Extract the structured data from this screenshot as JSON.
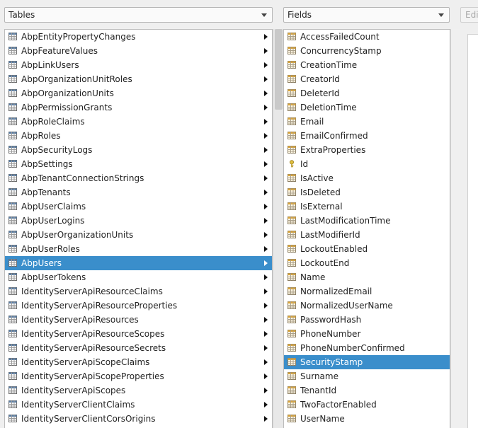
{
  "tables_combo": {
    "label": "Tables"
  },
  "fields_combo": {
    "label": "Fields"
  },
  "edit_button": {
    "label": "Edit"
  },
  "tables": {
    "selected": "AbpUsers",
    "items": [
      "AbpEntityPropertyChanges",
      "AbpFeatureValues",
      "AbpLinkUsers",
      "AbpOrganizationUnitRoles",
      "AbpOrganizationUnits",
      "AbpPermissionGrants",
      "AbpRoleClaims",
      "AbpRoles",
      "AbpSecurityLogs",
      "AbpSettings",
      "AbpTenantConnectionStrings",
      "AbpTenants",
      "AbpUserClaims",
      "AbpUserLogins",
      "AbpUserOrganizationUnits",
      "AbpUserRoles",
      "AbpUsers",
      "AbpUserTokens",
      "IdentityServerApiResourceClaims",
      "IdentityServerApiResourceProperties",
      "IdentityServerApiResources",
      "IdentityServerApiResourceScopes",
      "IdentityServerApiResourceSecrets",
      "IdentityServerApiScopeClaims",
      "IdentityServerApiScopeProperties",
      "IdentityServerApiScopes",
      "IdentityServerClientClaims",
      "IdentityServerClientCorsOrigins"
    ]
  },
  "fields": {
    "selected": "SecurityStamp",
    "items": [
      {
        "name": "AccessFailedCount",
        "icon": "table-field-icon"
      },
      {
        "name": "ConcurrencyStamp",
        "icon": "table-field-icon"
      },
      {
        "name": "CreationTime",
        "icon": "table-field-icon"
      },
      {
        "name": "CreatorId",
        "icon": "table-field-icon"
      },
      {
        "name": "DeleterId",
        "icon": "table-field-icon"
      },
      {
        "name": "DeletionTime",
        "icon": "table-field-icon"
      },
      {
        "name": "Email",
        "icon": "table-field-icon"
      },
      {
        "name": "EmailConfirmed",
        "icon": "table-field-icon"
      },
      {
        "name": "ExtraProperties",
        "icon": "table-field-icon"
      },
      {
        "name": "Id",
        "icon": "key-icon"
      },
      {
        "name": "IsActive",
        "icon": "table-field-icon"
      },
      {
        "name": "IsDeleted",
        "icon": "table-field-icon"
      },
      {
        "name": "IsExternal",
        "icon": "table-field-icon"
      },
      {
        "name": "LastModificationTime",
        "icon": "table-field-icon"
      },
      {
        "name": "LastModifierId",
        "icon": "table-field-icon"
      },
      {
        "name": "LockoutEnabled",
        "icon": "table-field-icon"
      },
      {
        "name": "LockoutEnd",
        "icon": "table-field-icon"
      },
      {
        "name": "Name",
        "icon": "table-field-icon"
      },
      {
        "name": "NormalizedEmail",
        "icon": "table-field-icon"
      },
      {
        "name": "NormalizedUserName",
        "icon": "table-field-icon"
      },
      {
        "name": "PasswordHash",
        "icon": "table-field-icon"
      },
      {
        "name": "PhoneNumber",
        "icon": "table-field-icon"
      },
      {
        "name": "PhoneNumberConfirmed",
        "icon": "table-field-icon"
      },
      {
        "name": "SecurityStamp",
        "icon": "table-field-icon"
      },
      {
        "name": "Surname",
        "icon": "table-field-icon"
      },
      {
        "name": "TenantId",
        "icon": "table-field-icon"
      },
      {
        "name": "TwoFactorEnabled",
        "icon": "table-field-icon"
      },
      {
        "name": "UserName",
        "icon": "table-field-icon"
      }
    ]
  },
  "colors": {
    "selection": "#3a8ecb",
    "key_icon": "#d7b52d",
    "table_icon_header": "#5b7fa6"
  }
}
